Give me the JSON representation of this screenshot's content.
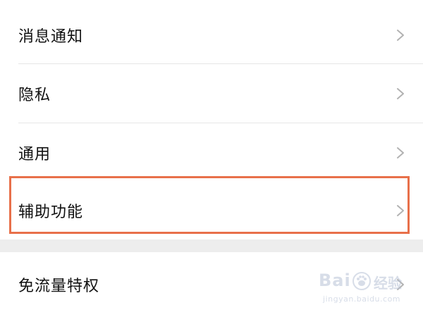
{
  "settings": {
    "items": [
      {
        "label": "消息通知",
        "icon": "chevron-right-icon"
      },
      {
        "label": "隐私",
        "icon": "chevron-right-icon"
      },
      {
        "label": "通用",
        "icon": "chevron-right-icon"
      },
      {
        "label": "辅助功能",
        "icon": "chevron-right-icon",
        "highlighted": true
      }
    ],
    "second_group": [
      {
        "label": "免流量特权",
        "icon": "chevron-right-icon"
      }
    ]
  },
  "watermark": {
    "brand": "Bai",
    "brand_suffix": "经验",
    "url": "jingyan.baidu.com"
  },
  "colors": {
    "background": "#ededed",
    "row_background": "#ffffff",
    "highlight_border": "#e8704a",
    "chevron": "#b2b2b2",
    "text": "#111111"
  }
}
